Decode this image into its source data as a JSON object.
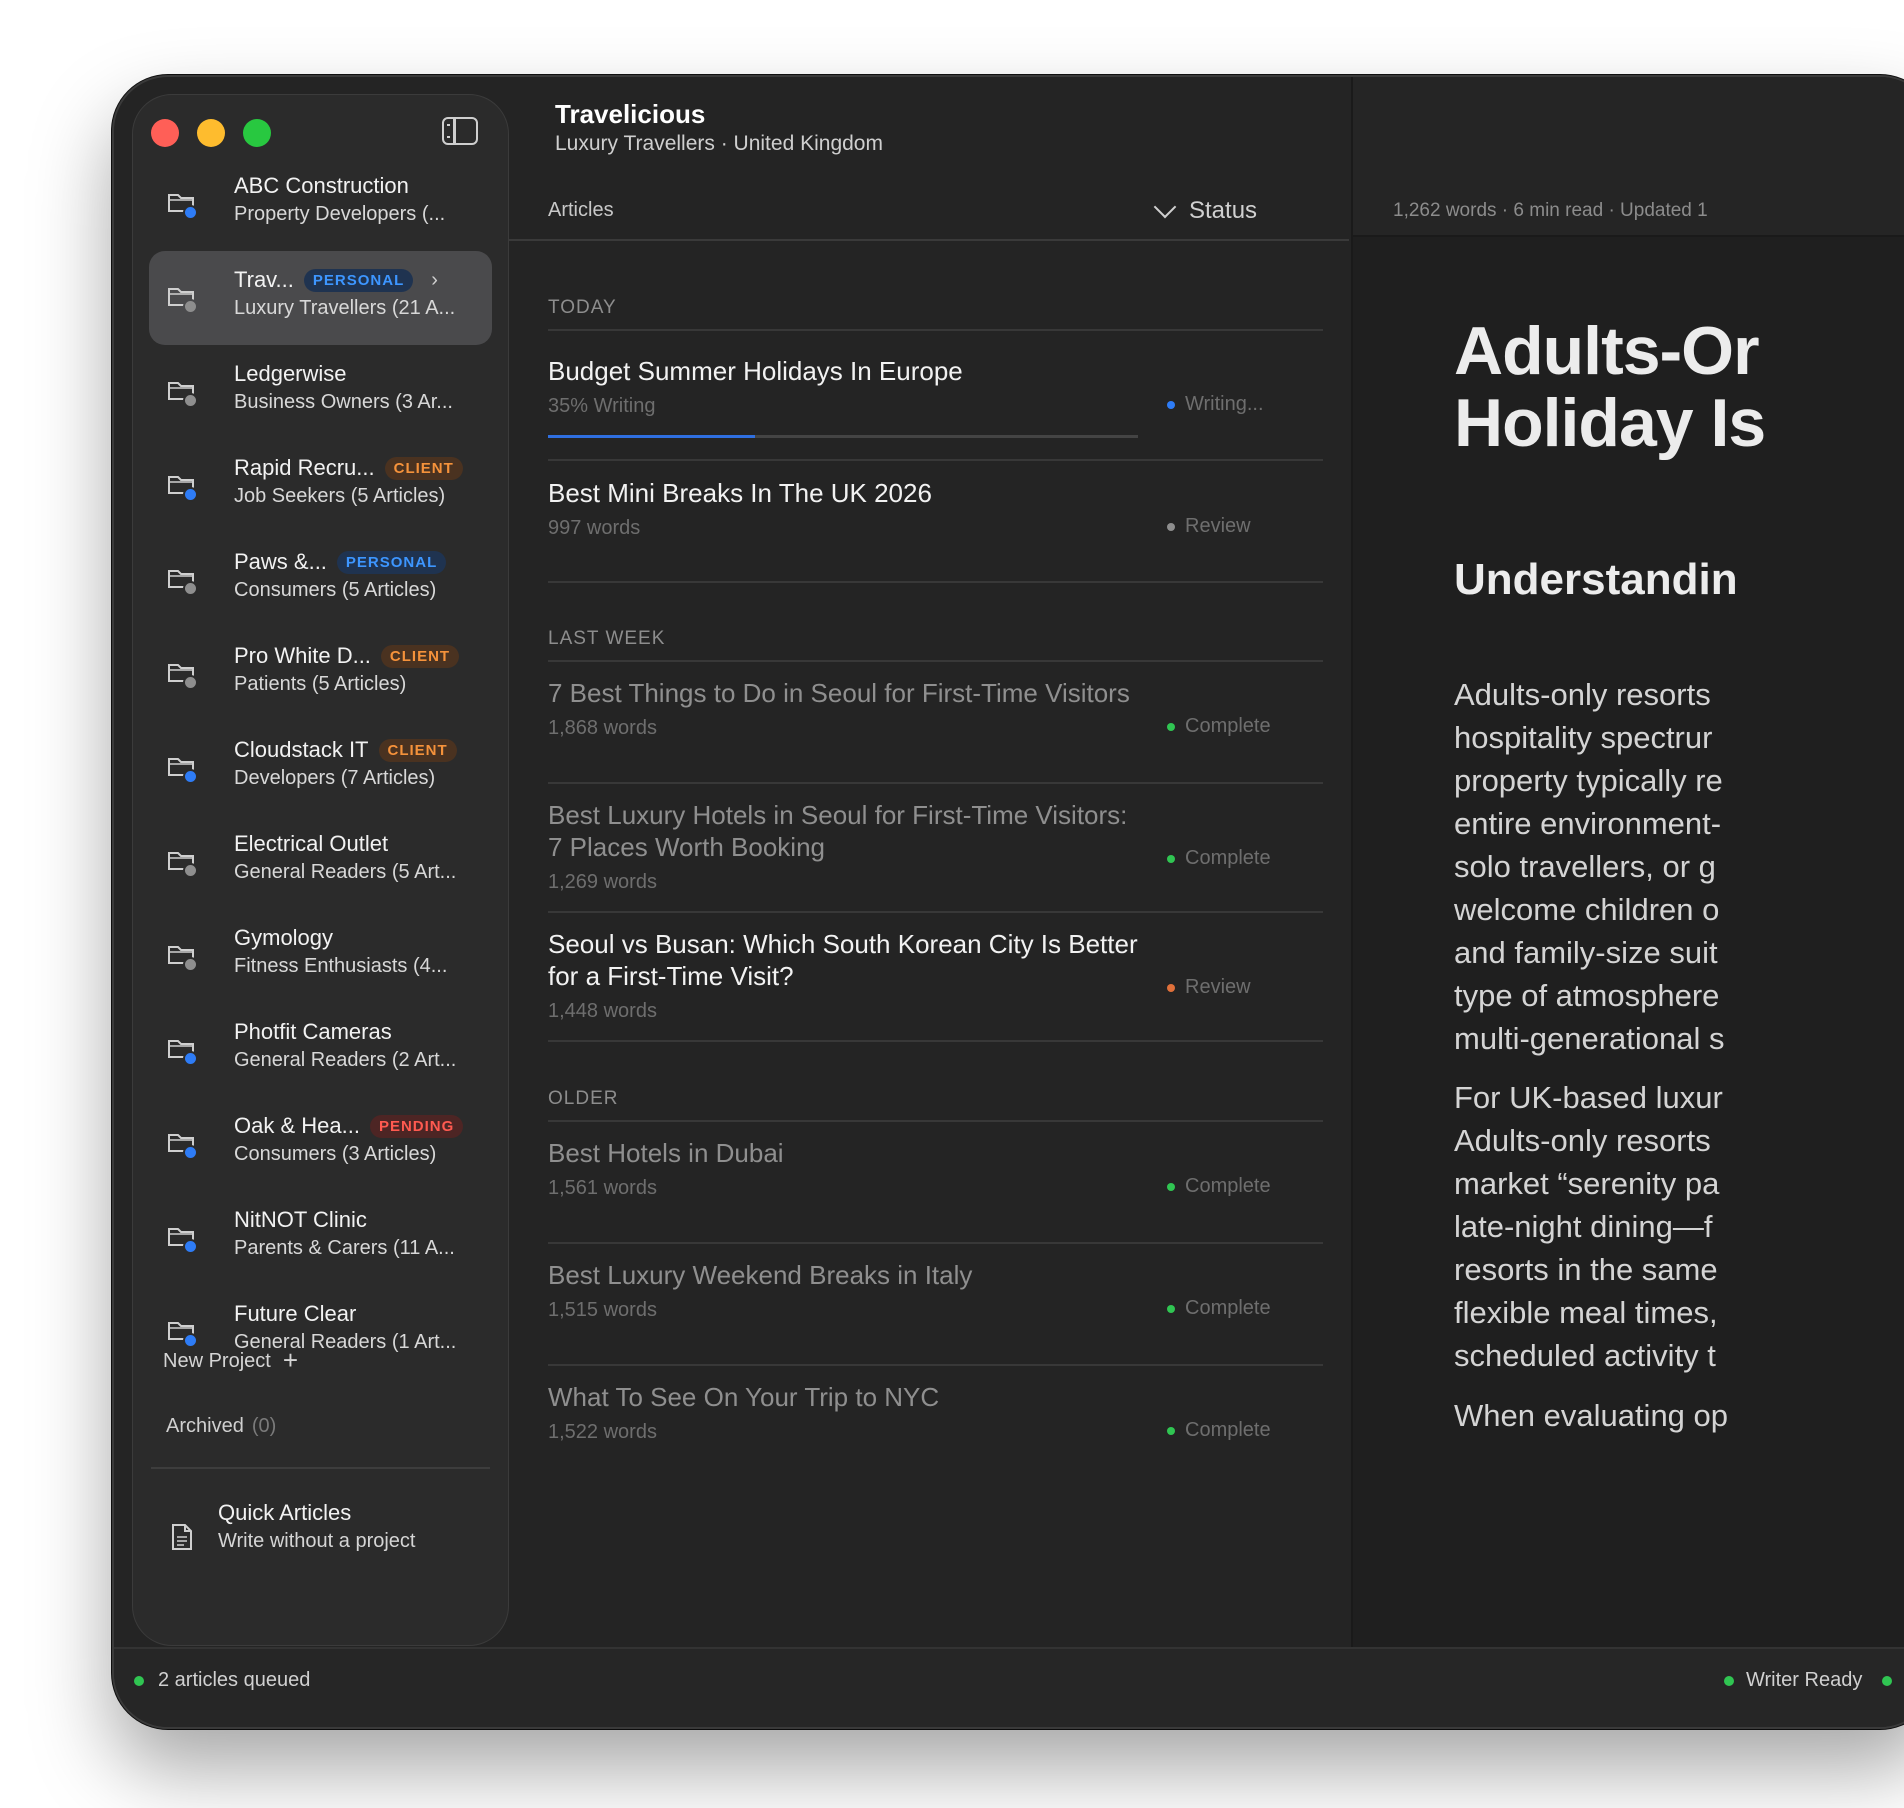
{
  "sidebar": {
    "projects": [
      {
        "name": "ABC Construction",
        "sub": "Property Developers (...",
        "tag": "",
        "tag_type": "",
        "icon": "folder-check-icon",
        "active": false
      },
      {
        "name": "Trav...",
        "sub": "Luxury Travellers (21 A...",
        "tag": "PERSONAL",
        "tag_type": "personal",
        "icon": "folder-icon",
        "active": true
      },
      {
        "name": "Ledgerwise",
        "sub": "Business Owners (3 Ar...",
        "tag": "",
        "tag_type": "",
        "icon": "folder-icon",
        "active": false
      },
      {
        "name": "Rapid Recru...",
        "sub": "Job Seekers (5 Articles)",
        "tag": "CLIENT",
        "tag_type": "client",
        "icon": "folder-check-icon",
        "active": false
      },
      {
        "name": "Paws &...",
        "sub": "Consumers (5 Articles)",
        "tag": "PERSONAL",
        "tag_type": "personal",
        "icon": "folder-icon",
        "active": false
      },
      {
        "name": "Pro White D...",
        "sub": "Patients (5 Articles)",
        "tag": "CLIENT",
        "tag_type": "client",
        "icon": "folder-icon",
        "active": false
      },
      {
        "name": "Cloudstack IT",
        "sub": "Developers (7 Articles)",
        "tag": "CLIENT",
        "tag_type": "client",
        "icon": "folder-check-icon",
        "active": false
      },
      {
        "name": "Electrical Outlet",
        "sub": "General Readers (5 Art...",
        "tag": "",
        "tag_type": "",
        "icon": "folder-icon",
        "active": false
      },
      {
        "name": "Gymology",
        "sub": "Fitness Enthusiasts (4...",
        "tag": "",
        "tag_type": "",
        "icon": "folder-icon",
        "active": false
      },
      {
        "name": "Photfit Cameras",
        "sub": "General Readers (2 Art...",
        "tag": "",
        "tag_type": "",
        "icon": "folder-check-icon",
        "active": false
      },
      {
        "name": "Oak & Hea...",
        "sub": "Consumers (3 Articles)",
        "tag": "PENDING",
        "tag_type": "pending",
        "icon": "folder-check-icon",
        "active": false
      },
      {
        "name": "NitNOT Clinic",
        "sub": "Parents & Carers (11 A...",
        "tag": "",
        "tag_type": "",
        "icon": "folder-check-icon",
        "active": false
      },
      {
        "name": "Future Clear",
        "sub": "General Readers (1 Art...",
        "tag": "",
        "tag_type": "",
        "icon": "folder-check-icon",
        "active": false
      }
    ],
    "new_project_label": "New Project",
    "archived_label": "Archived",
    "archived_count": "(0)",
    "quick_title": "Quick Articles",
    "quick_sub": "Write without a project"
  },
  "list": {
    "project_title": "Travelicious",
    "project_sub": "Luxury Travellers · United Kingdom",
    "col_articles": "Articles",
    "col_status": "Status",
    "sections": [
      {
        "label": "TODAY"
      },
      {
        "label": "LAST WEEK"
      },
      {
        "label": "OLDER"
      }
    ],
    "rows": [
      {
        "title": "Budget Summer Holidays In Europe",
        "meta": "35% Writing",
        "status": "Writing...",
        "status_color": "#2e7cf6",
        "bright": true,
        "progress": 0.35
      },
      {
        "title": "Best Mini Breaks In The UK 2026",
        "meta": "997 words",
        "status": "Review",
        "status_color": "#8e8e8e",
        "bright": true
      },
      {
        "title": "7 Best Things to Do in Seoul for First-Time Visitors",
        "meta": "1,868 words",
        "status": "Complete",
        "status_color": "#30c552",
        "bright": false
      },
      {
        "title": "Best Luxury Hotels in Seoul for First-Time Visitors: 7 Places Worth Booking",
        "meta": "1,269 words",
        "status": "Complete",
        "status_color": "#30c552",
        "bright": false
      },
      {
        "title": "Seoul vs Busan: Which South Korean City Is Better for a First-Time Visit?",
        "meta": "1,448 words",
        "status": "Review",
        "status_color": "#e0703a",
        "bright": true
      },
      {
        "title": "Best Hotels in Dubai",
        "meta": "1,561 words",
        "status": "Complete",
        "status_color": "#30c552",
        "bright": false
      },
      {
        "title": "Best Luxury Weekend Breaks in Italy",
        "meta": "1,515 words",
        "status": "Complete",
        "status_color": "#30c552",
        "bright": false
      },
      {
        "title": "What To See On Your Trip to NYC",
        "meta": "1,522 words",
        "status": "Complete",
        "status_color": "#30c552",
        "bright": false
      }
    ]
  },
  "reader": {
    "meta": "1,262 words · 6 min read · Updated 1",
    "h1_line1": "Adults-Or",
    "h1_line2": "Holiday Is",
    "h2": "Understandin",
    "para1": [
      "Adults-only resorts",
      "hospitality spectrur",
      "property typically re",
      "entire environment-",
      "solo travellers, or g",
      "welcome children o",
      "and family-size suit",
      "type of atmosphere",
      "multi-generational s"
    ],
    "para2": [
      "For UK-based luxur",
      "Adults-only resorts",
      "market “serenity pa",
      "late-night dining—f",
      "resorts in the same",
      "flexible meal times,",
      "scheduled activity t"
    ],
    "para3": [
      "When evaluating op"
    ]
  },
  "statusbar": {
    "queued": "2 articles queued",
    "writer": "Writer Ready"
  }
}
